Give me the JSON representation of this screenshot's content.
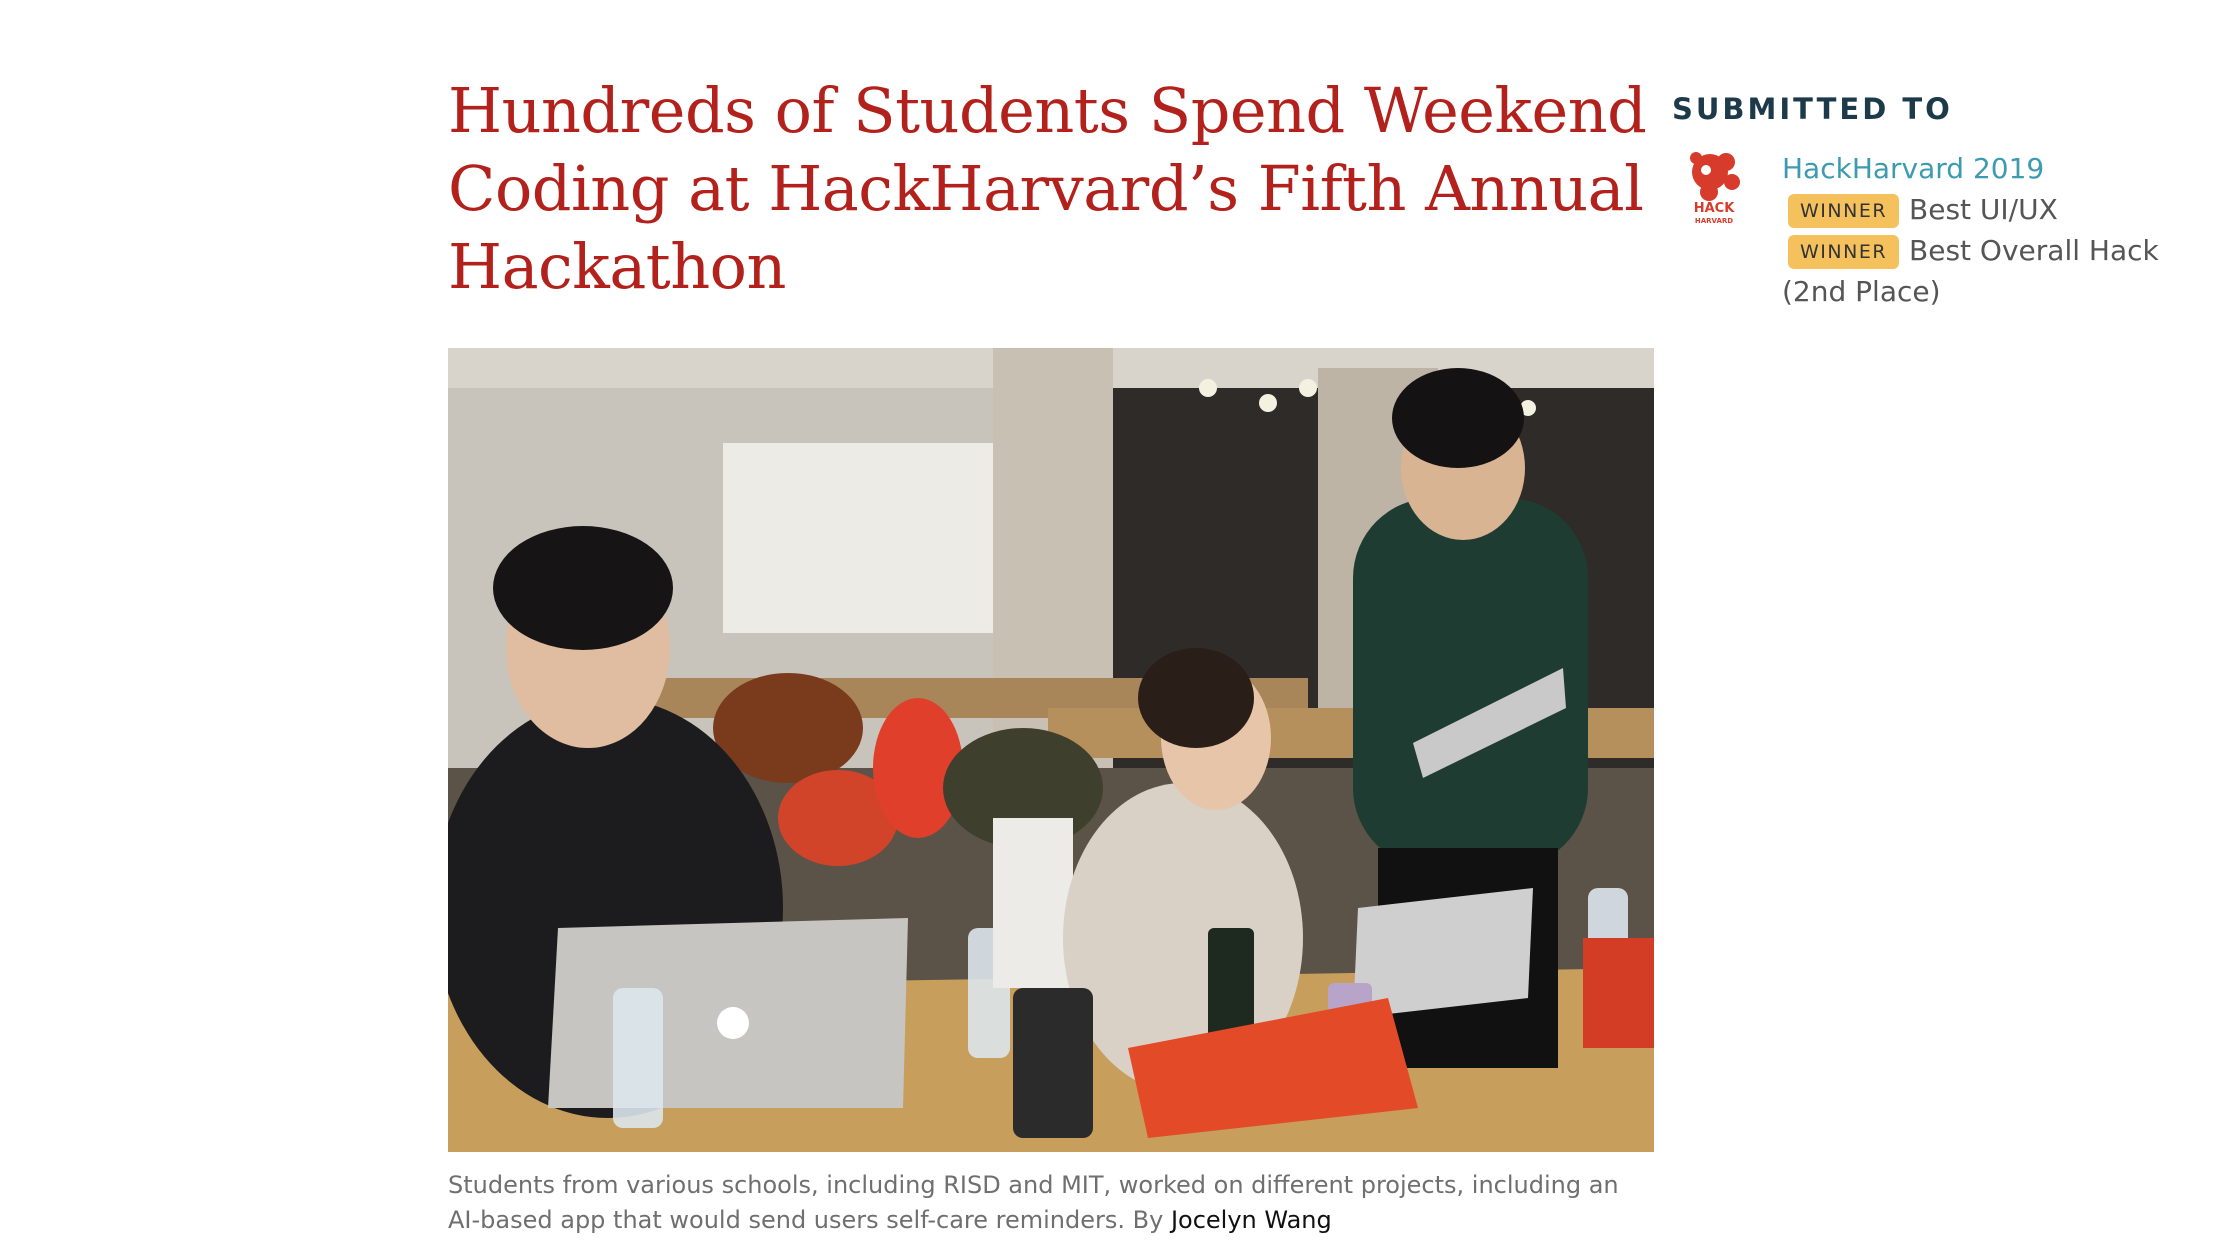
{
  "article": {
    "headline": "Hundreds of Students Spend Weekend Coding at HackHarvard’s Fifth Annual Hackathon",
    "caption": "Students from various schools, including RISD and MIT, worked on different projects, including an AI-based app that would send users self-care reminders. By ",
    "byline_name": "Jocelyn Wang"
  },
  "sidebar": {
    "heading": "SUBMITTED TO",
    "submission": {
      "event_name": "HackHarvard 2019",
      "logo_text_top": "HACK",
      "logo_text_bottom": "HARVARD",
      "prizes": [
        {
          "badge": "WINNER",
          "name": "Best UI/UX"
        },
        {
          "badge": "WINNER",
          "name": "Best Overall Hack (2nd Place)"
        }
      ]
    }
  },
  "colors": {
    "headline": "#b3211c",
    "link": "#3d9bb0",
    "badge": "#f5c15d",
    "heading": "#1c3a4a"
  }
}
